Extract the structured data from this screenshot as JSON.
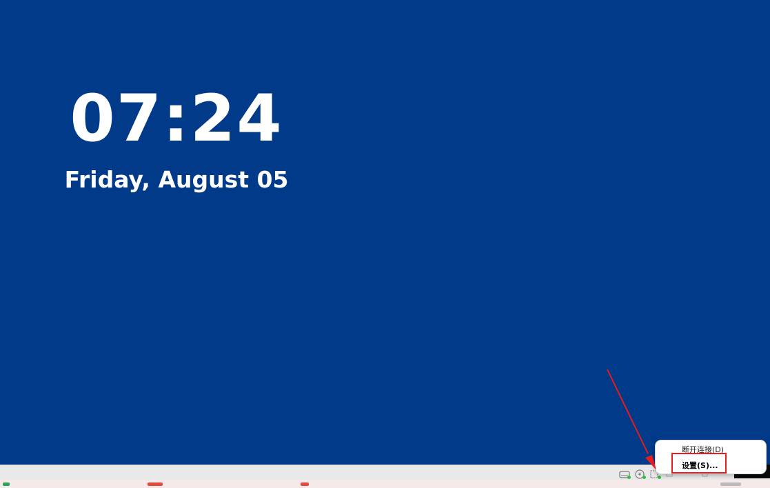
{
  "lockscreen": {
    "time": "07:24",
    "date": "Friday, August 05"
  },
  "context_menu": {
    "items": [
      {
        "label": "断开连接(D)"
      },
      {
        "label": "设置(S)..."
      }
    ]
  },
  "status_icons": [
    "drive-icon",
    "disc-icon",
    "network-icon",
    "display-icon",
    "usb-icon"
  ],
  "colors": {
    "background": "#013a89",
    "annotation": "#e41e1e",
    "status_dot": "#2dbf3b"
  }
}
